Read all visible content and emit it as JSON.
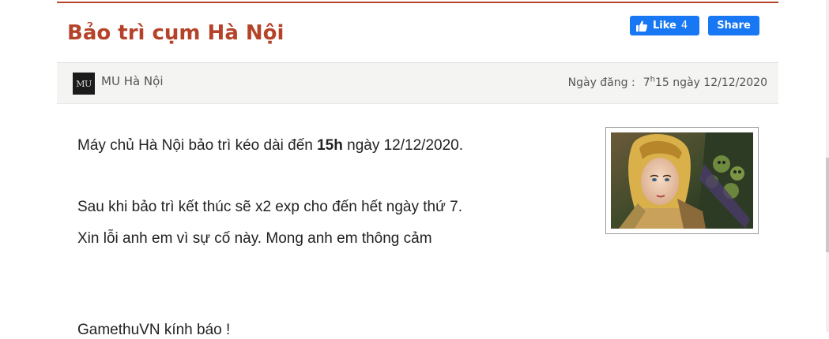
{
  "article": {
    "title": "Bảo trì cụm Hà Nội",
    "social": {
      "like_label": "Like",
      "like_count": "4",
      "share_label": "Share"
    },
    "meta": {
      "author_logo_text": "MU",
      "author": "MU Hà Nội",
      "date_label": "Ngày đăng :",
      "time_hour": "7",
      "time_h": "h",
      "time_rest": "15 ngày 12/12/2020"
    },
    "body": {
      "p1_before": "Máy chủ Hà Nội bảo trì kéo dài đến ",
      "p1_bold": "15h",
      "p1_after": " ngày 12/12/2020.",
      "p2": "Sau khi bảo trì kết thúc sẽ x2 exp cho đến hết ngày thứ 7.",
      "p3": "Xin lỗi anh em vì sự cố này. Mong anh em thông cảm",
      "p4": "GamethuVN kính báo !"
    }
  },
  "colors": {
    "title": "#b5432a",
    "facebook_blue": "#1877f2",
    "meta_bar_bg": "#f4f4f2"
  },
  "icons": [
    "thumbs-up-icon",
    "author-logo-icon"
  ]
}
